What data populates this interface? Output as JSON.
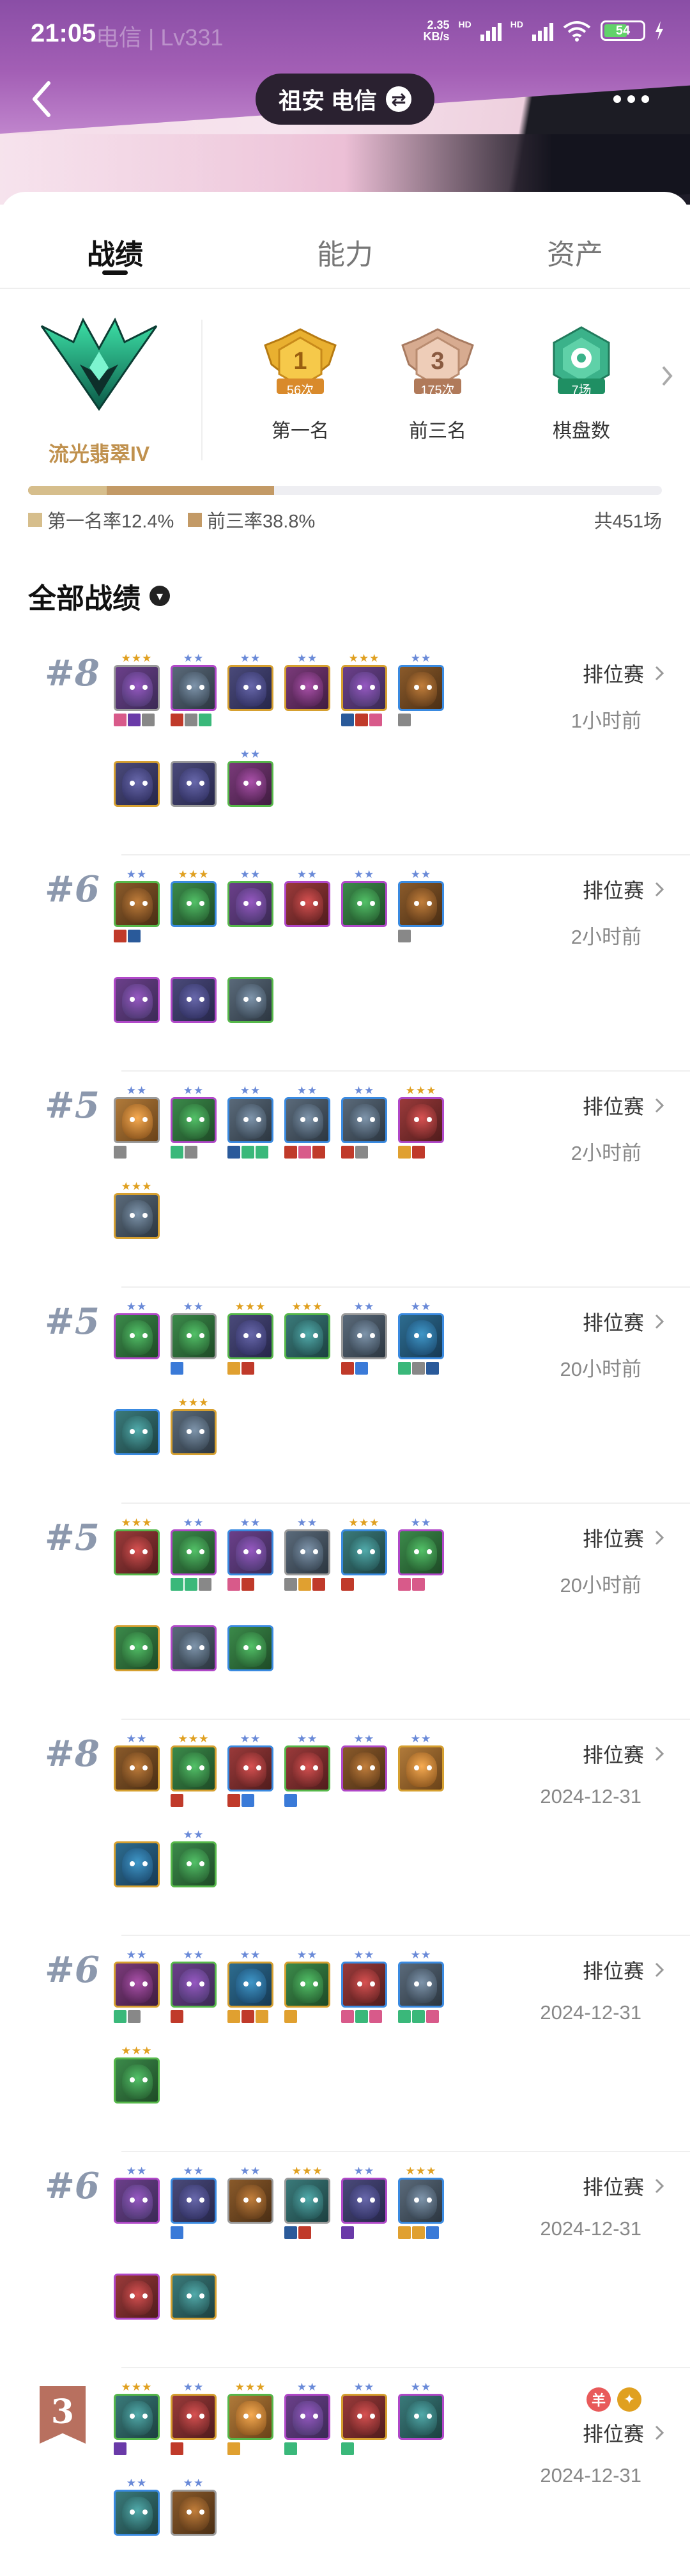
{
  "status": {
    "time": "21:05",
    "ghost_text": "电信 | Lv331",
    "net_speed_value": "2.35",
    "net_speed_unit": "KB/s",
    "hd": "HD",
    "battery": "54"
  },
  "nav": {
    "server": "祖安 电信",
    "swap_icon": "swap-icon"
  },
  "tabs": [
    {
      "label": "战绩",
      "active": true
    },
    {
      "label": "能力",
      "active": false
    },
    {
      "label": "资产",
      "active": false
    }
  ],
  "rank": {
    "name": "流光翡翠IV",
    "stats": [
      {
        "badge": "1",
        "count": "56次",
        "label": "第一名",
        "color": "#e9b030"
      },
      {
        "badge": "3",
        "count": "175次",
        "label": "前三名",
        "color": "#c99a7a"
      },
      {
        "badge": "✿",
        "count": "7场",
        "label": "棋盘数",
        "color": "#3bb28a"
      }
    ]
  },
  "progress": {
    "first_rate": 0.124,
    "top3_rate": 0.388,
    "first_label": "第一名率12.4%",
    "top3_label": "前三率38.8%",
    "total": "共451场",
    "color_first": "#d6be8c",
    "color_top3": "#c39a66"
  },
  "section": {
    "title": "全部战绩"
  },
  "matches": [
    {
      "placement": "#8",
      "mode": "排位赛",
      "time": "1小时前",
      "rows": [
        6,
        3
      ]
    },
    {
      "placement": "#6",
      "mode": "排位赛",
      "time": "2小时前",
      "rows": [
        6,
        3
      ]
    },
    {
      "placement": "#5",
      "mode": "排位赛",
      "time": "2小时前",
      "rows": [
        6,
        1
      ]
    },
    {
      "placement": "#5",
      "mode": "排位赛",
      "time": "20小时前",
      "rows": [
        6,
        2
      ]
    },
    {
      "placement": "#5",
      "mode": "排位赛",
      "time": "20小时前",
      "rows": [
        6,
        3
      ]
    },
    {
      "placement": "#8",
      "mode": "排位赛",
      "time": "2024-12-31",
      "rows": [
        6,
        2
      ]
    },
    {
      "placement": "#6",
      "mode": "排位赛",
      "time": "2024-12-31",
      "rows": [
        6,
        1
      ]
    },
    {
      "placement": "#6",
      "mode": "排位赛",
      "time": "2024-12-31",
      "rows": [
        6,
        2
      ]
    },
    {
      "placement": "3",
      "mode": "排位赛",
      "time": "2024-12-31",
      "rows": [
        6,
        2
      ],
      "badge": true,
      "tags": [
        {
          "text": "羊",
          "color": "#e85a5a"
        },
        {
          "text": "✦",
          "color": "#e0a020"
        }
      ]
    }
  ]
}
